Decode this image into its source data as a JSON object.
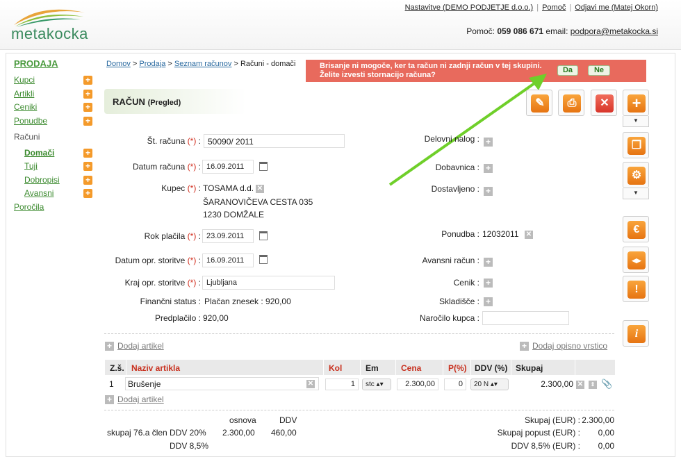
{
  "header": {
    "logo": "metakocka",
    "links": [
      "Nastavitve (DEMO PODJETJE d.o.o.)",
      "Pomoč",
      "Odjavi me (Matej Okorn)"
    ],
    "help_label": "Pomoč:",
    "help_phone": "059 086 671",
    "email_label": "email:",
    "email": "podpora@metakocka.si"
  },
  "sidebar": {
    "section": "PRODAJA",
    "items": [
      {
        "label": "Kupci"
      },
      {
        "label": "Artikli"
      },
      {
        "label": "Ceniki"
      },
      {
        "label": "Ponudbe"
      },
      {
        "label": "Računi"
      },
      {
        "label": "Domači"
      },
      {
        "label": "Tuji"
      },
      {
        "label": "Dobropisi"
      },
      {
        "label": "Avansni"
      },
      {
        "label": "Poročila"
      }
    ]
  },
  "breadcrumb": [
    "Domov",
    "Prodaja",
    "Seznam računov",
    "Računi - domači"
  ],
  "alert": {
    "line1": "Brisanje ni mogoče, ker ta račun ni zadnji račun v tej skupini.",
    "line2": "Želite izvesti stornacijo računa?",
    "yes": "Da",
    "no": "Ne"
  },
  "title": {
    "main": "RAČUN",
    "sub": "(Pregled)"
  },
  "form": {
    "req": "(*)",
    "invoice_no_label": "Št. računa",
    "invoice_no": "50090/ 2011",
    "date_label": "Datum računa",
    "date": "16.09.2011",
    "customer_label": "Kupec",
    "customer_name": "TOSAMA d.d.",
    "customer_street": "ŠARANOVIČEVA CESTA 035",
    "customer_city": "1230 DOMŽALE",
    "due_label": "Rok plačila",
    "due": "23.09.2011",
    "service_date_label": "Datum opr. storitve",
    "service_date": "16.09.2011",
    "service_place_label": "Kraj opr. storitve",
    "service_place": "Ljubljana",
    "fin_status_label": "Finančni status :",
    "fin_status": "Plačan znesek : 920,00",
    "prepaid_label": "Predplačilo :",
    "prepaid": "920,00",
    "work_order_label": "Delovni nalog :",
    "delivery_note_label": "Dobavnica :",
    "delivered_label": "Dostavljeno :",
    "quote_label": "Ponudba :",
    "quote": "12032011",
    "advance_label": "Avansni račun :",
    "pricelist_label": "Cenik :",
    "warehouse_label": "Skladišče :",
    "order_label": "Naročilo kupca :"
  },
  "links": {
    "add_item": "Dodaj artikel",
    "add_desc": "Dodaj opisno vrstico"
  },
  "table": {
    "headers": [
      "Z.š.",
      "Naziv artikla",
      "Kol",
      "Em",
      "Cena",
      "P(%)",
      "DDV (%)",
      "Skupaj"
    ],
    "row": {
      "no": "1",
      "name": "Brušenje",
      "qty": "1",
      "unit": "stc",
      "price": "2.300,00",
      "disc": "0",
      "vat": "20 N",
      "total": "2.300,00"
    }
  },
  "totals": {
    "col_base": "osnova",
    "col_vat": "DDV",
    "row1_label": "skupaj 76.a člen",
    "row1_vat_label": "DDV 20%",
    "row1_base": "2.300,00",
    "row1_vat": "460,00",
    "row2_vat_label": "DDV 8,5%",
    "sum_label": "Skupaj (EUR) :",
    "sum": "2.300,00",
    "discount_label": "Skupaj popust (EUR) :",
    "discount": "0,00",
    "vat85_label": "DDV 8,5% (EUR) :",
    "vat85": "0,00"
  }
}
